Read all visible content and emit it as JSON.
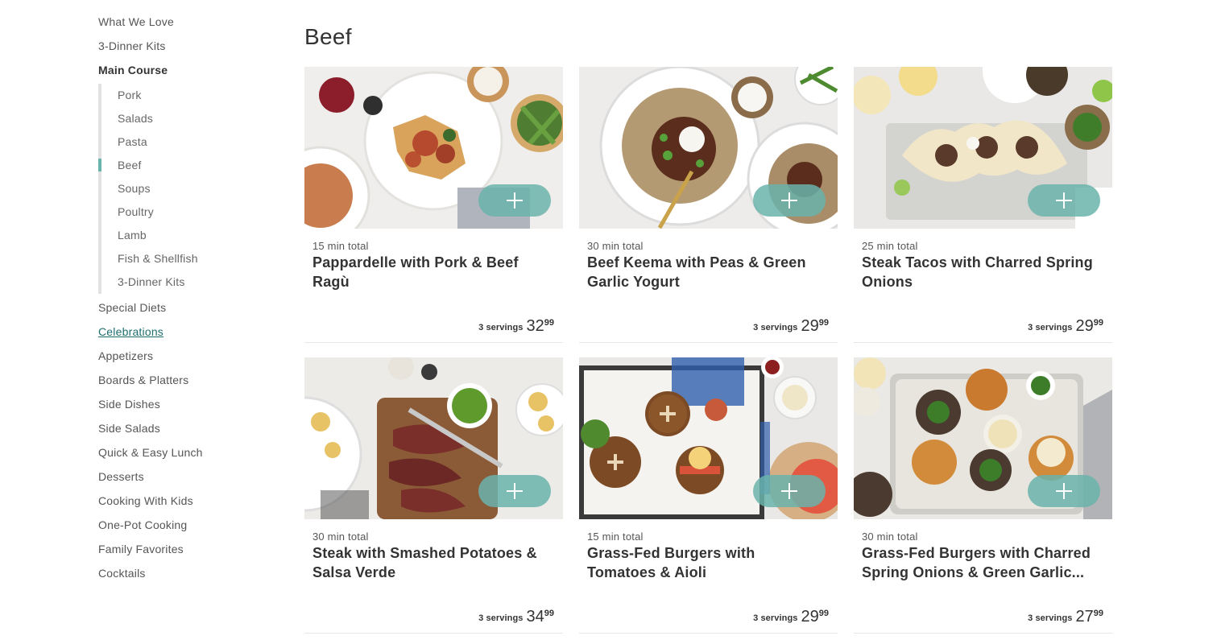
{
  "sidebar": {
    "top_items": [
      {
        "label": "What We Love"
      },
      {
        "label": "3-Dinner Kits"
      },
      {
        "label": "Main Course"
      }
    ],
    "sub_items": [
      {
        "label": "Pork"
      },
      {
        "label": "Salads"
      },
      {
        "label": "Pasta"
      },
      {
        "label": "Beef"
      },
      {
        "label": "Soups"
      },
      {
        "label": "Poultry"
      },
      {
        "label": "Lamb"
      },
      {
        "label": "Fish & Shellfish"
      },
      {
        "label": "3-Dinner Kits"
      }
    ],
    "bottom_items": [
      {
        "label": "Special Diets"
      },
      {
        "label": "Celebrations"
      },
      {
        "label": "Appetizers"
      },
      {
        "label": "Boards & Platters"
      },
      {
        "label": "Side Dishes"
      },
      {
        "label": "Side Salads"
      },
      {
        "label": "Quick & Easy Lunch"
      },
      {
        "label": "Desserts"
      },
      {
        "label": "Cooking With Kids"
      },
      {
        "label": "One-Pot Cooking"
      },
      {
        "label": "Family Favorites"
      },
      {
        "label": "Cocktails"
      }
    ]
  },
  "page": {
    "title": "Beef"
  },
  "colors": {
    "accent": "#6ab3ab",
    "link": "#1f6e6e",
    "text": "#333333"
  },
  "products": [
    {
      "time": "15 min total",
      "name": "Pappardelle with Pork & Beef Ragù",
      "servings": "3 servings",
      "dollars": "32",
      "cents": "99"
    },
    {
      "time": "30 min total",
      "name": "Beef Keema with Peas & Green Garlic Yogurt",
      "servings": "3 servings",
      "dollars": "29",
      "cents": "99"
    },
    {
      "time": "25 min total",
      "name": "Steak Tacos with Charred Spring Onions",
      "servings": "3 servings",
      "dollars": "29",
      "cents": "99"
    },
    {
      "time": "30 min total",
      "name": "Steak with Smashed Potatoes & Salsa Verde",
      "servings": "3 servings",
      "dollars": "34",
      "cents": "99"
    },
    {
      "time": "15 min total",
      "name": "Grass-Fed Burgers with Tomatoes & Aioli",
      "servings": "3 servings",
      "dollars": "29",
      "cents": "99"
    },
    {
      "time": "30 min total",
      "name": "Grass-Fed Burgers with Charred Spring Onions & Green Garlic...",
      "servings": "3 servings",
      "dollars": "27",
      "cents": "99"
    }
  ]
}
